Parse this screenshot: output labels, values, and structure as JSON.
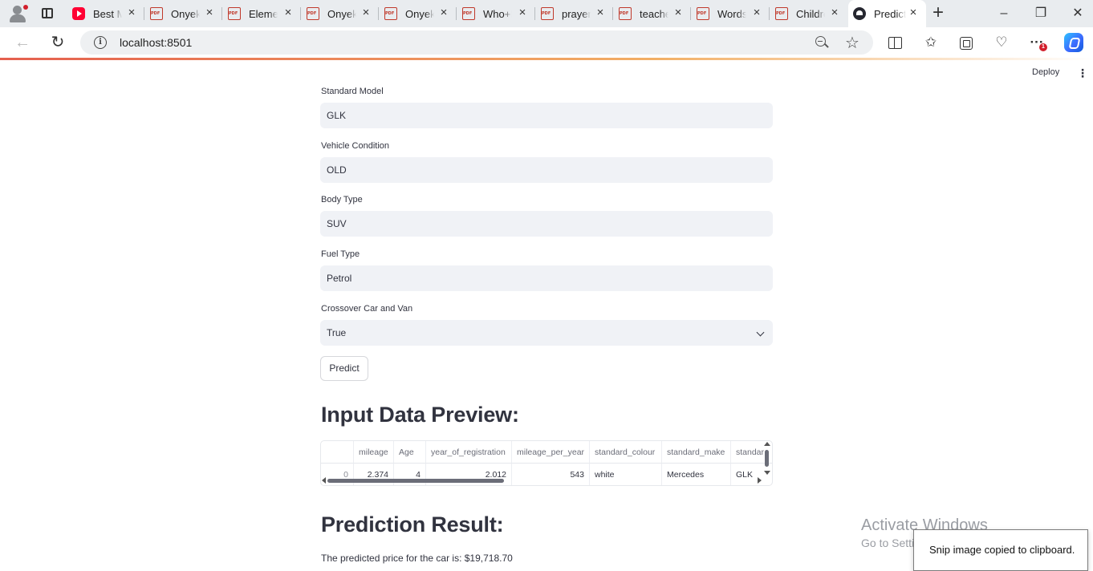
{
  "browser": {
    "tabs": [
      {
        "title": "Best M",
        "favicon": "youtube-icon"
      },
      {
        "title": "Onyek",
        "favicon": "pdf-icon"
      },
      {
        "title": "Elemen",
        "favicon": "pdf-icon"
      },
      {
        "title": "Onyek",
        "favicon": "pdf-icon"
      },
      {
        "title": "Onyek",
        "favicon": "pdf-icon"
      },
      {
        "title": "Who+I",
        "favicon": "pdf-icon"
      },
      {
        "title": "prayer",
        "favicon": "pdf-icon"
      },
      {
        "title": "teache",
        "favicon": "pdf-icon"
      },
      {
        "title": "Words",
        "favicon": "pdf-icon"
      },
      {
        "title": "Childre",
        "favicon": "pdf-icon"
      },
      {
        "title": "Predict",
        "favicon": "streamlit-icon",
        "active": true
      }
    ],
    "url": "localhost:8501",
    "notification_count": "1"
  },
  "app": {
    "deploy_label": "Deploy",
    "fields": {
      "standard_model": {
        "label": "Standard Model",
        "value": "GLK"
      },
      "vehicle_condition": {
        "label": "Vehicle Condition",
        "value": "OLD"
      },
      "body_type": {
        "label": "Body Type",
        "value": "SUV"
      },
      "fuel_type": {
        "label": "Fuel Type",
        "value": "Petrol"
      },
      "crossover": {
        "label": "Crossover Car and Van",
        "value": "True"
      }
    },
    "predict_label": "Predict",
    "preview_heading": "Input Data Preview:",
    "table": {
      "columns": [
        "",
        "mileage",
        "Age",
        "year_of_registration",
        "mileage_per_year",
        "standard_colour",
        "standard_make",
        "standar"
      ],
      "row": [
        "0",
        "2.374",
        "4",
        "2.012",
        "543",
        "white",
        "Mercedes",
        "GLK"
      ]
    },
    "result_heading": "Prediction Result:",
    "result_text": "The predicted price for the car is: $19,718.70"
  },
  "os": {
    "watermark_line1": "Activate Windows",
    "watermark_line2": "Go to Settings to activate Windows.",
    "toast": "Snip image copied to clipboard."
  },
  "colors": {
    "accent": "#ff4b4b",
    "field_bg": "#f0f2f6",
    "text": "#31333f"
  }
}
